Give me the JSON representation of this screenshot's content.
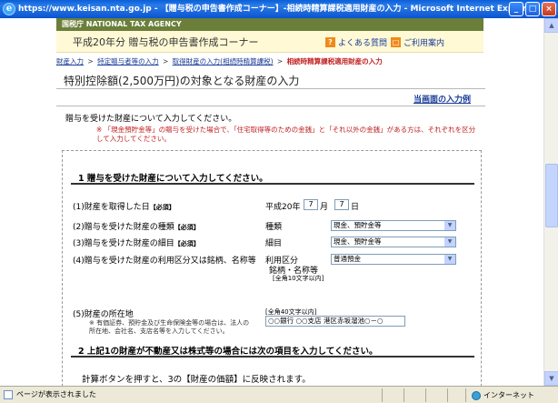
{
  "window": {
    "title": "https://www.keisan.nta.go.jp - 【贈与税の申告書作成コーナー】-相続時精算課税適用財産の入力 - Microsoft Internet Explorer",
    "minimize": "_",
    "maximize": "□",
    "close": "×"
  },
  "header": {
    "agency": "国税庁 NATIONAL TAX AGENCY",
    "app_title": "平成20年分 贈与税の申告書作成コーナー",
    "faq": "よくある質問",
    "guide": "ご利用案内"
  },
  "breadcrumb": {
    "items": [
      "財産入力",
      "特定贈与者等の入力",
      "取得財産の入力(相続時精算課税)"
    ],
    "separator": ">",
    "current": "相続時精算課税適用財産の入力"
  },
  "main": {
    "heading": "特別控除額(2,500万円)の対象となる財産の入力",
    "sample_link": "当画面の入力例",
    "intro": "贈与を受けた財産について入力してください。",
    "note": "※ 「現金預貯金等」の贈与を受けた場合で、「住宅取得等のための金銭」と「それ以外の金銭」がある方は、それぞれを区分して入力してください。"
  },
  "section1": {
    "title": "1 贈与を受けた財産について入力してください。",
    "required_tag": "【必須】",
    "rows": [
      {
        "label": "(1)財産を取得した日"
      },
      {
        "label": "(2)贈与を受けた財産の種類",
        "field_label": "種類",
        "value": "現金、預貯金等"
      },
      {
        "label": "(3)贈与を受けた財産の細目",
        "field_label": "細目",
        "value": "現金、預貯金等"
      },
      {
        "label": "(4)贈与を受けた財産の利用区分又は銘柄、名称等",
        "field_label": "利用区分",
        "field_label2": "銘柄・名称等",
        "field_note": "[全角10文字以内]",
        "value": "普通預金"
      },
      {
        "label": "(5)財産の所在地",
        "field_note": "[全角40文字以内]",
        "value": "○○銀行 ○○支店 港区赤坂溜池○－○",
        "sub_note": "※ 有価証券、預貯金及び生命保険金等の場合は、法人の所在地、会社名、支店名等を入力してください。"
      }
    ],
    "date": {
      "era": "平成20年",
      "month": "7",
      "month_unit": "月",
      "day": "7",
      "day_unit": "日"
    }
  },
  "section2": {
    "title": "2 上記1の財産が不動産又は株式等の場合には次の項目を入力してください。",
    "text": "計算ボタンを押すと、3の【財産の価額】に反映されます。"
  },
  "statusbar": {
    "text": "ページが表示されました",
    "zone": "インターネット"
  }
}
